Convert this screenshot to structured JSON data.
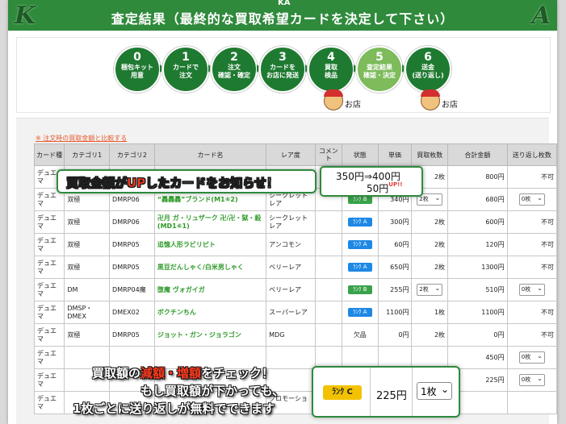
{
  "header": {
    "title": "査定結果（最終的な買取希望カードを決定して下さい）",
    "left_logo": "K",
    "right_logo": "A",
    "crest": "KA",
    "color": "#2f8a3c"
  },
  "steps": [
    {
      "num": "0",
      "label": "梱包キット\n用意",
      "active": false
    },
    {
      "num": "1",
      "label": "カードで\n注文",
      "active": false
    },
    {
      "num": "2",
      "label": "注文\n確認・確定",
      "active": false
    },
    {
      "num": "3",
      "label": "カードを\nお店に発送",
      "active": false
    },
    {
      "num": "4",
      "label": "買取\n検品",
      "active": false
    },
    {
      "num": "5",
      "label": "査定結果\n確認・決定",
      "active": true
    },
    {
      "num": "6",
      "label": "送金\n(送り返し)",
      "active": false
    }
  ],
  "shop_label": "お店",
  "compare_link": "※ 注文時の買取金額と比較する",
  "columns": [
    "カード種",
    "カテゴリ1",
    "カテゴリ2",
    "カード名",
    "レア度",
    "コメント",
    "状態",
    "単価",
    "買取枚数",
    "合計金額",
    "送り返し枚数"
  ],
  "rows": [
    {
      "kind": "デュエマ",
      "cat1": "",
      "cat2": "",
      "name": "",
      "rarity": "",
      "comment": "",
      "rank": "",
      "price": "",
      "qty": "2枚",
      "qty_select": false,
      "total": "800円",
      "return": "不可",
      "return_select": false
    },
    {
      "kind": "デュエマ",
      "cat1": "双極",
      "cat2": "DMRP06",
      "name": "“轟轟轟”ブランド(M1⑥2)",
      "rarity": "シークレットレア",
      "comment": "",
      "rank": "B",
      "price": "340円",
      "qty": "2枚",
      "qty_select": true,
      "total": "680円",
      "return": "0枚",
      "return_select": true
    },
    {
      "kind": "デュエマ",
      "cat1": "双極",
      "cat2": "DMRP06",
      "name": "卍月 ガ・リュザーク 卍/卍・獄・殺(MD1⑥1)",
      "rarity": "シークレットレア",
      "comment": "",
      "rank": "A",
      "price": "300円",
      "qty": "2枚",
      "qty_select": false,
      "total": "600円",
      "return": "不可",
      "return_select": false
    },
    {
      "kind": "デュエマ",
      "cat1": "双極",
      "cat2": "DMRP05",
      "name": "追憶人形ラビリピト",
      "rarity": "アンコモン",
      "comment": "",
      "rank": "A",
      "price": "60円",
      "qty": "2枚",
      "qty_select": false,
      "total": "120円",
      "return": "不可",
      "return_select": false
    },
    {
      "kind": "デュエマ",
      "cat1": "双極",
      "cat2": "DMRP05",
      "name": "黒豆だんしゃく/白米男しゃく",
      "rarity": "ベリーレア",
      "comment": "",
      "rank": "A",
      "price": "650円",
      "qty": "2枚",
      "qty_select": false,
      "total": "1300円",
      "return": "不可",
      "return_select": false
    },
    {
      "kind": "デュエマ",
      "cat1": "DM",
      "cat2": "DMRP04魔",
      "name": "堕魔 ヴォガイガ",
      "rarity": "ベリーレア",
      "comment": "",
      "rank": "B",
      "price": "255円",
      "qty": "2枚",
      "qty_select": true,
      "total": "510円",
      "return": "0枚",
      "return_select": true
    },
    {
      "kind": "デュエマ",
      "cat1": "DMSP・DMEX",
      "cat2": "DMEX02",
      "name": "ボクチンちん",
      "rarity": "スーパーレア",
      "comment": "",
      "rank": "A",
      "price": "1100円",
      "qty": "1枚",
      "qty_select": false,
      "total": "1100円",
      "return": "不可",
      "return_select": false
    },
    {
      "kind": "デュエマ",
      "cat1": "双極",
      "cat2": "DMRP05",
      "name": "ジョット・ガン・ジョラゴン",
      "rarity": "MDG",
      "comment": "",
      "rank": "欠品",
      "price": "0円",
      "qty": "2枚",
      "qty_select": false,
      "total": "0円",
      "return": "不可",
      "return_select": false
    },
    {
      "kind": "デュエマ",
      "cat1": "",
      "cat2": "",
      "name": "",
      "rarity": "",
      "comment": "",
      "rank": "",
      "price": "",
      "qty": "",
      "qty_select": false,
      "total": "450円",
      "return": "0枚",
      "return_select": true
    },
    {
      "kind": "デュエマ",
      "cat1": "",
      "cat2": "",
      "name": "",
      "rarity": "",
      "comment": "",
      "rank": "",
      "price": "",
      "qty": "",
      "qty_select": false,
      "total": "225円",
      "return": "0枚",
      "return_select": true
    },
    {
      "kind": "デュエマ",
      "cat1": "",
      "cat2": "",
      "name": "",
      "rarity": "プロモーション",
      "comment": "",
      "rank": "",
      "price": "",
      "qty": "",
      "qty_select": false,
      "total": "",
      "return": "",
      "return_select": false
    }
  ],
  "callout_up": {
    "pre": "買取金額が",
    "hl": "UP",
    "post": "したカードをお知らせ！"
  },
  "price_change": {
    "line1": "350円⇒400円",
    "line2": "50円",
    "up": "UP!!"
  },
  "callout_check": {
    "l1_pre": "買取額の",
    "l1_hl": "減額・増額",
    "l1_post": "をチェック！",
    "l2": "もし買取額が下かっても、",
    "l3": "1枚ごとに送り返しが無料でできます"
  },
  "zoom": {
    "rank": "ﾗﾝｸ C",
    "price": "225円",
    "qty": "1枚"
  }
}
